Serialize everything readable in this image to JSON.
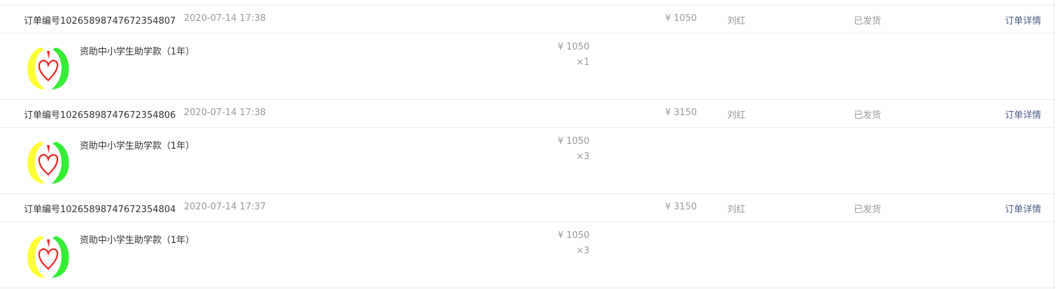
{
  "orders": [
    {
      "order_no": "订单编号10265898747672354807",
      "time": "2020-07-14 17:38",
      "total": "¥ 1050",
      "recipient": "刘红",
      "status": "已发货",
      "detail_link": "订单详情",
      "item": {
        "name": "资助中小学生助学款（1年）",
        "price": "¥ 1050",
        "quantity": "×1",
        "image_icon": "charity-heart-logo"
      }
    },
    {
      "order_no": "订单编号10265898747672354806",
      "time": "2020-07-14 17:38",
      "total": "¥ 3150",
      "recipient": "刘红",
      "status": "已发货",
      "detail_link": "订单详情",
      "item": {
        "name": "资助中小学生助学款（1年）",
        "price": "¥ 1050",
        "quantity": "×3",
        "image_icon": "charity-heart-logo"
      }
    },
    {
      "order_no": "订单编号10265898747672354804",
      "time": "2020-07-14 17:37",
      "total": "¥ 3150",
      "recipient": "刘红",
      "status": "已发货",
      "detail_link": "订单详情",
      "item": {
        "name": "资助中小学生助学款（1年）",
        "price": "¥ 1050",
        "quantity": "×3",
        "image_icon": "charity-heart-logo"
      }
    }
  ],
  "colors": {
    "link": "#4a5a86",
    "muted": "#999999",
    "text": "#333333",
    "border": "#e8e8e8",
    "logo_yellow": "#ffff33",
    "logo_green": "#33ee33",
    "logo_red": "#ee2222"
  }
}
